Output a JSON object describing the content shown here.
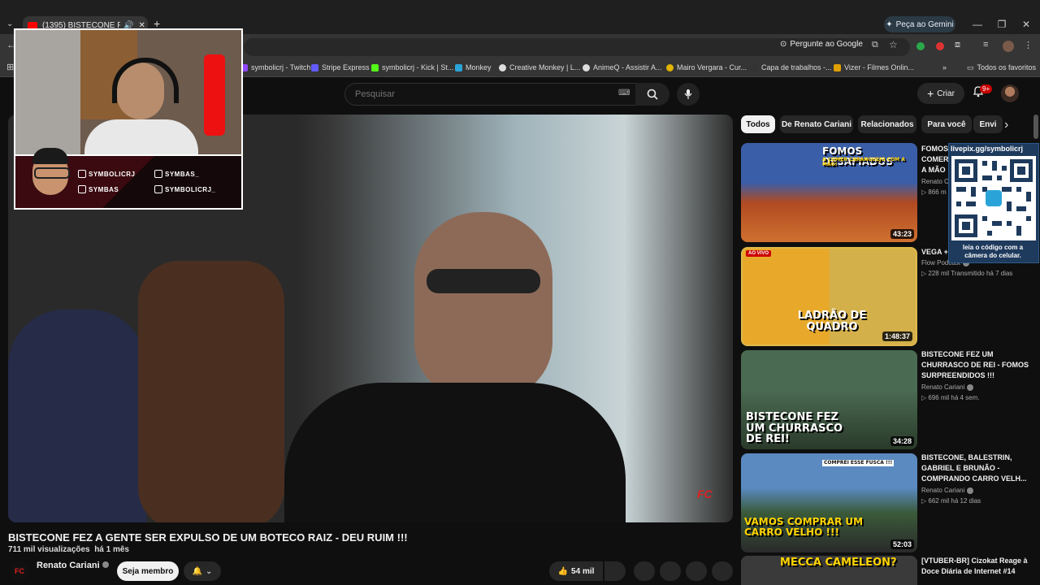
{
  "browser": {
    "tab_title": "(1395) BISTECONE FEZ A GE",
    "gemini_label": "Peça ao Gemini",
    "ask_google": "Pergunte ao Google",
    "bookmarks": [
      {
        "label": "symbolicrj - Twitch",
        "color": "#9146ff"
      },
      {
        "label": "Stripe Express",
        "color": "#635bff"
      },
      {
        "label": "symbolicrj - Kick | St...",
        "color": "#53fc18"
      },
      {
        "label": "Monkey",
        "color": "#2aa4d8"
      },
      {
        "label": "Creative Monkey | L...",
        "color": "#dddddd"
      },
      {
        "label": "AnimeQ - Assistir A...",
        "color": "#dddddd"
      },
      {
        "label": "Mairo Vergara - Cur...",
        "color": "#e0b400"
      },
      {
        "label": "Capa de trabalhos -...",
        "color": "#333333"
      },
      {
        "label": "Vizer - Filmes Onlin...",
        "color": "#e0a000"
      }
    ],
    "all_favorites": "Todos os favoritos"
  },
  "header": {
    "search_placeholder": "Pesquisar",
    "create_label": "Criar",
    "notif_count": "9+"
  },
  "stream_overlay": {
    "socials": [
      "SYMBOLICRJ",
      "SYMBAS_",
      "SYMBAS",
      "SYMBOLICRJ_"
    ]
  },
  "video": {
    "logo_text": "FC",
    "title": "BISTECONE FEZ A GENTE SER EXPULSO DE UM BOTECO RAIZ - DEU RUIM !!!",
    "views": "711 mil visualizações",
    "age": "há 1 mês",
    "channel": "Renato Cariani",
    "join_label": "Seja membro",
    "likes": "54 mil"
  },
  "chips": [
    "Todos",
    "De Renato Cariani",
    "Relacionados",
    "Para você",
    "Envi"
  ],
  "sidebar": [
    {
      "thumb_caption": "FOMOS DESAFIADOS",
      "thumb_sub": "A COMER CARANGUEJO COM A MÃO!",
      "duration": "43:23",
      "title": "FOMOS ... COMER ... A MÃO",
      "title_lines": [
        "FOMOS",
        "COMER",
        "A MÃO"
      ],
      "channel": "Renato C",
      "meta": "866 m"
    },
    {
      "live_tag": "AO VIVO",
      "thumb_caption": "LADRÃO DE QUADRO",
      "duration": "1:48:37",
      "title_lines": [
        "VEGA +"
      ],
      "channel": "Flow Podcast",
      "meta": "228 mil   Transmitido há 7 dias"
    },
    {
      "thumb_caption": "BISTECONE FEZ UM CHURRASCO DE REI!",
      "duration": "34:28",
      "title_lines": [
        "BISTECONE FEZ UM",
        "CHURRASCO DE REI - FOMOS",
        "SURPREENDIDOS !!!"
      ],
      "channel": "Renato Cariani",
      "meta": "696 mil   há 4 sem."
    },
    {
      "thumb_sub": "COMPREI ESSE FUSCA !!!",
      "thumb_caption": "VAMOS COMPRAR UM CARRO VELHO !!!",
      "duration": "52:03",
      "title_lines": [
        "BISTECONE, BALESTRIN,",
        "GABRIEL E BRUNÃO -",
        "COMPRANDO CARRO VELH..."
      ],
      "channel": "Renato Cariani",
      "meta": "662 mil   há 12 dias"
    },
    {
      "thumb_caption": "MECCA CAMELEON?",
      "title_lines": [
        "[VTUBER-BR] Cizokat Reage à",
        "Doce Diária de Internet #14"
      ]
    }
  ],
  "qr_overlay": {
    "url": "livepix.gg/symbolicrj",
    "note": "leia o código com a câmera do celular."
  }
}
